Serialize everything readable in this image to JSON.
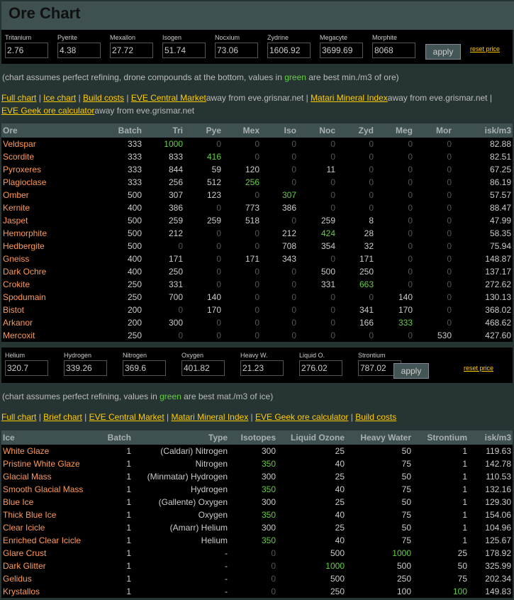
{
  "title": "Ore Chart",
  "ore_prices": {
    "fields": [
      {
        "label": "Tritanium",
        "value": "2.76"
      },
      {
        "label": "Pyerite",
        "value": "4.38"
      },
      {
        "label": "Mexallon",
        "value": "27.72"
      },
      {
        "label": "Isogen",
        "value": "51.74"
      },
      {
        "label": "Nocxium",
        "value": "73.06"
      },
      {
        "label": "Zydrine",
        "value": "1606.92"
      },
      {
        "label": "Megacyte",
        "value": "3699.69"
      },
      {
        "label": "Morphite",
        "value": "8068"
      }
    ],
    "apply": "apply",
    "reset": "reset price"
  },
  "ore_note": {
    "pre": "(chart assumes perfect refining, drone compounds at the bottom, values in ",
    "green": "green",
    "post": " are best min./m3 of ore)"
  },
  "ore_links": {
    "full": "Full chart",
    "ice": "Ice chart",
    "build": "Build costs",
    "central": "EVE Central Market",
    "away1": "away from eve.grisnar.net",
    "matari": "Matari Mineral Index",
    "away2": "away from eve.grismar.net",
    "geek": "EVE Geek ore calculator",
    "away3": "away from eve.grismar.net",
    "sep": " | "
  },
  "ore_table": {
    "headers": [
      "Ore",
      "Batch",
      "Tri",
      "Pye",
      "Mex",
      "Iso",
      "Noc",
      "Zyd",
      "Meg",
      "Mor",
      "isk/m3"
    ],
    "rows": [
      {
        "name": "Veldspar",
        "batch": "333",
        "v": [
          "1000",
          "0",
          "0",
          "0",
          "0",
          "0",
          "0",
          "0"
        ],
        "best": 0,
        "isk": "82.88"
      },
      {
        "name": "Scordite",
        "batch": "333",
        "v": [
          "833",
          "416",
          "0",
          "0",
          "0",
          "0",
          "0",
          "0"
        ],
        "best": 1,
        "isk": "82.51"
      },
      {
        "name": "Pyroxeres",
        "batch": "333",
        "v": [
          "844",
          "59",
          "120",
          "0",
          "11",
          "0",
          "0",
          "0"
        ],
        "best": -1,
        "isk": "67.25"
      },
      {
        "name": "Plagioclase",
        "batch": "333",
        "v": [
          "256",
          "512",
          "256",
          "0",
          "0",
          "0",
          "0",
          "0"
        ],
        "best": 2,
        "isk": "86.19"
      },
      {
        "name": "Omber",
        "batch": "500",
        "v": [
          "307",
          "123",
          "0",
          "307",
          "0",
          "0",
          "0",
          "0"
        ],
        "best": 3,
        "isk": "57.57"
      },
      {
        "name": "Kernite",
        "batch": "400",
        "v": [
          "386",
          "0",
          "773",
          "386",
          "0",
          "0",
          "0",
          "0"
        ],
        "best": -1,
        "isk": "88.47"
      },
      {
        "name": "Jaspet",
        "batch": "500",
        "v": [
          "259",
          "259",
          "518",
          "0",
          "259",
          "8",
          "0",
          "0"
        ],
        "best": -1,
        "isk": "47.99"
      },
      {
        "name": "Hemorphite",
        "batch": "500",
        "v": [
          "212",
          "0",
          "0",
          "212",
          "424",
          "28",
          "0",
          "0"
        ],
        "best": 4,
        "isk": "58.35"
      },
      {
        "name": "Hedbergite",
        "batch": "500",
        "v": [
          "0",
          "0",
          "0",
          "708",
          "354",
          "32",
          "0",
          "0"
        ],
        "best": -1,
        "isk": "75.94"
      },
      {
        "name": "Gneiss",
        "batch": "400",
        "v": [
          "171",
          "0",
          "171",
          "343",
          "0",
          "171",
          "0",
          "0"
        ],
        "best": -1,
        "isk": "148.87"
      },
      {
        "name": "Dark Ochre",
        "batch": "400",
        "v": [
          "250",
          "0",
          "0",
          "0",
          "500",
          "250",
          "0",
          "0"
        ],
        "best": -1,
        "isk": "137.17"
      },
      {
        "name": "Crokite",
        "batch": "250",
        "v": [
          "331",
          "0",
          "0",
          "0",
          "331",
          "663",
          "0",
          "0"
        ],
        "best": 5,
        "isk": "272.62"
      },
      {
        "name": "Spodumain",
        "batch": "250",
        "v": [
          "700",
          "140",
          "0",
          "0",
          "0",
          "0",
          "140",
          "0"
        ],
        "best": -1,
        "isk": "130.13"
      },
      {
        "name": "Bistot",
        "batch": "200",
        "v": [
          "0",
          "170",
          "0",
          "0",
          "0",
          "341",
          "170",
          "0"
        ],
        "best": -1,
        "isk": "368.02"
      },
      {
        "name": "Arkanor",
        "batch": "200",
        "v": [
          "300",
          "0",
          "0",
          "0",
          "0",
          "166",
          "333",
          "0"
        ],
        "best": 6,
        "isk": "468.62"
      },
      {
        "name": "Mercoxit",
        "batch": "250",
        "v": [
          "0",
          "0",
          "0",
          "0",
          "0",
          "0",
          "0",
          "530"
        ],
        "best": -1,
        "isk": "427.60"
      }
    ]
  },
  "ice_prices": {
    "fields": [
      {
        "label": "Helium",
        "value": "320.7"
      },
      {
        "label": "Hydrogen",
        "value": "339.26"
      },
      {
        "label": "Nitrogen",
        "value": "369.6"
      },
      {
        "label": "Oxygen",
        "value": "401.82"
      },
      {
        "label": "Heavy W.",
        "value": "21.23"
      },
      {
        "label": "Liquid O.",
        "value": "276.02"
      },
      {
        "label": "Strontium",
        "value": "787.02"
      }
    ],
    "apply": "apply",
    "reset": "reset price"
  },
  "ice_note": {
    "pre": "(chart assumes perfect refining, values in ",
    "green": "green",
    "post": " are best mat./m3 of ice)"
  },
  "ice_links": {
    "full": "Full chart",
    "brief": "Brief chart",
    "central": "EVE Central Market",
    "matari": "Matari Mineral Index",
    "geek": "EVE Geek ore calculator",
    "build": "Build costs",
    "sep": " | "
  },
  "ice_table": {
    "headers": [
      "Ice",
      "Batch",
      "Type",
      "Isotopes",
      "Liquid Ozone",
      "Heavy Water",
      "Strontium",
      "isk/m3"
    ],
    "rows": [
      {
        "name": "White Glaze",
        "batch": "1",
        "type": "(Caldari) Nitrogen",
        "v": [
          "300",
          "25",
          "50",
          "1"
        ],
        "best": -1,
        "isk": "119.63"
      },
      {
        "name": "Pristine White Glaze",
        "batch": "1",
        "type": "Nitrogen",
        "v": [
          "350",
          "40",
          "75",
          "1"
        ],
        "best": 0,
        "isk": "142.78"
      },
      {
        "name": "Glacial Mass",
        "batch": "1",
        "type": "(Minmatar) Hydrogen",
        "v": [
          "300",
          "25",
          "50",
          "1"
        ],
        "best": -1,
        "isk": "110.53"
      },
      {
        "name": "Smooth Glacial Mass",
        "batch": "1",
        "type": "Hydrogen",
        "v": [
          "350",
          "40",
          "75",
          "1"
        ],
        "best": 0,
        "isk": "132.16"
      },
      {
        "name": "Blue Ice",
        "batch": "1",
        "type": "(Gallente) Oxygen",
        "v": [
          "300",
          "25",
          "50",
          "1"
        ],
        "best": -1,
        "isk": "129.30"
      },
      {
        "name": "Thick Blue Ice",
        "batch": "1",
        "type": "Oxygen",
        "v": [
          "350",
          "40",
          "75",
          "1"
        ],
        "best": 0,
        "isk": "154.06"
      },
      {
        "name": "Clear Icicle",
        "batch": "1",
        "type": "(Amarr) Helium",
        "v": [
          "300",
          "25",
          "50",
          "1"
        ],
        "best": -1,
        "isk": "104.96"
      },
      {
        "name": "Enriched Clear Icicle",
        "batch": "1",
        "type": "Helium",
        "v": [
          "350",
          "40",
          "75",
          "1"
        ],
        "best": 0,
        "isk": "125.67"
      },
      {
        "name": "Glare Crust",
        "batch": "1",
        "type": "-",
        "v": [
          "0",
          "500",
          "1000",
          "25"
        ],
        "best": 2,
        "isk": "178.92"
      },
      {
        "name": "Dark Glitter",
        "batch": "1",
        "type": "-",
        "v": [
          "0",
          "1000",
          "500",
          "50"
        ],
        "best": 1,
        "isk": "325.99"
      },
      {
        "name": "Gelidus",
        "batch": "1",
        "type": "-",
        "v": [
          "0",
          "500",
          "250",
          "75"
        ],
        "best": -1,
        "isk": "202.34"
      },
      {
        "name": "Krystallos",
        "batch": "1",
        "type": "-",
        "v": [
          "0",
          "250",
          "100",
          "100"
        ],
        "best": 3,
        "isk": "149.83"
      }
    ]
  }
}
